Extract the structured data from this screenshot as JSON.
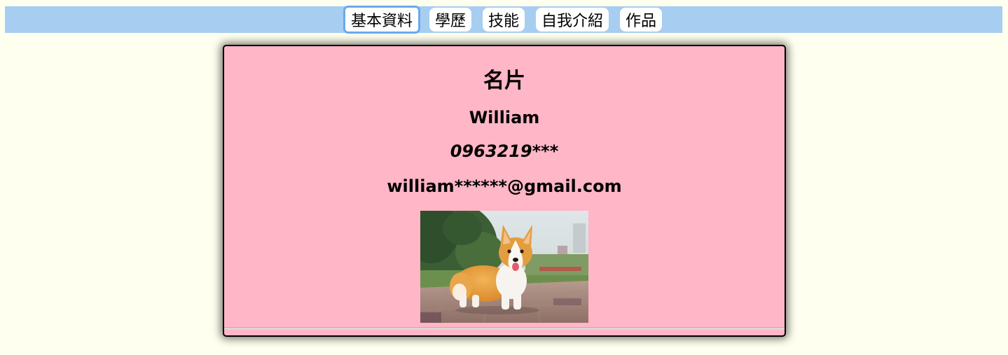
{
  "nav": {
    "tabs": [
      {
        "label": "基本資料",
        "active": true
      },
      {
        "label": "學歷"
      },
      {
        "label": "技能"
      },
      {
        "label": "自我介紹"
      },
      {
        "label": "作品"
      }
    ]
  },
  "card": {
    "title": "名片",
    "name": "William",
    "phone": "0963219***",
    "email": "william******@gmail.com",
    "photo_subject": "corgi-dog-photo"
  },
  "colors": {
    "page_bg": "#fffff0",
    "nav_bg": "#a7cdf0",
    "card_bg": "#ffb6c6",
    "active_outline": "#6aa9ef"
  }
}
